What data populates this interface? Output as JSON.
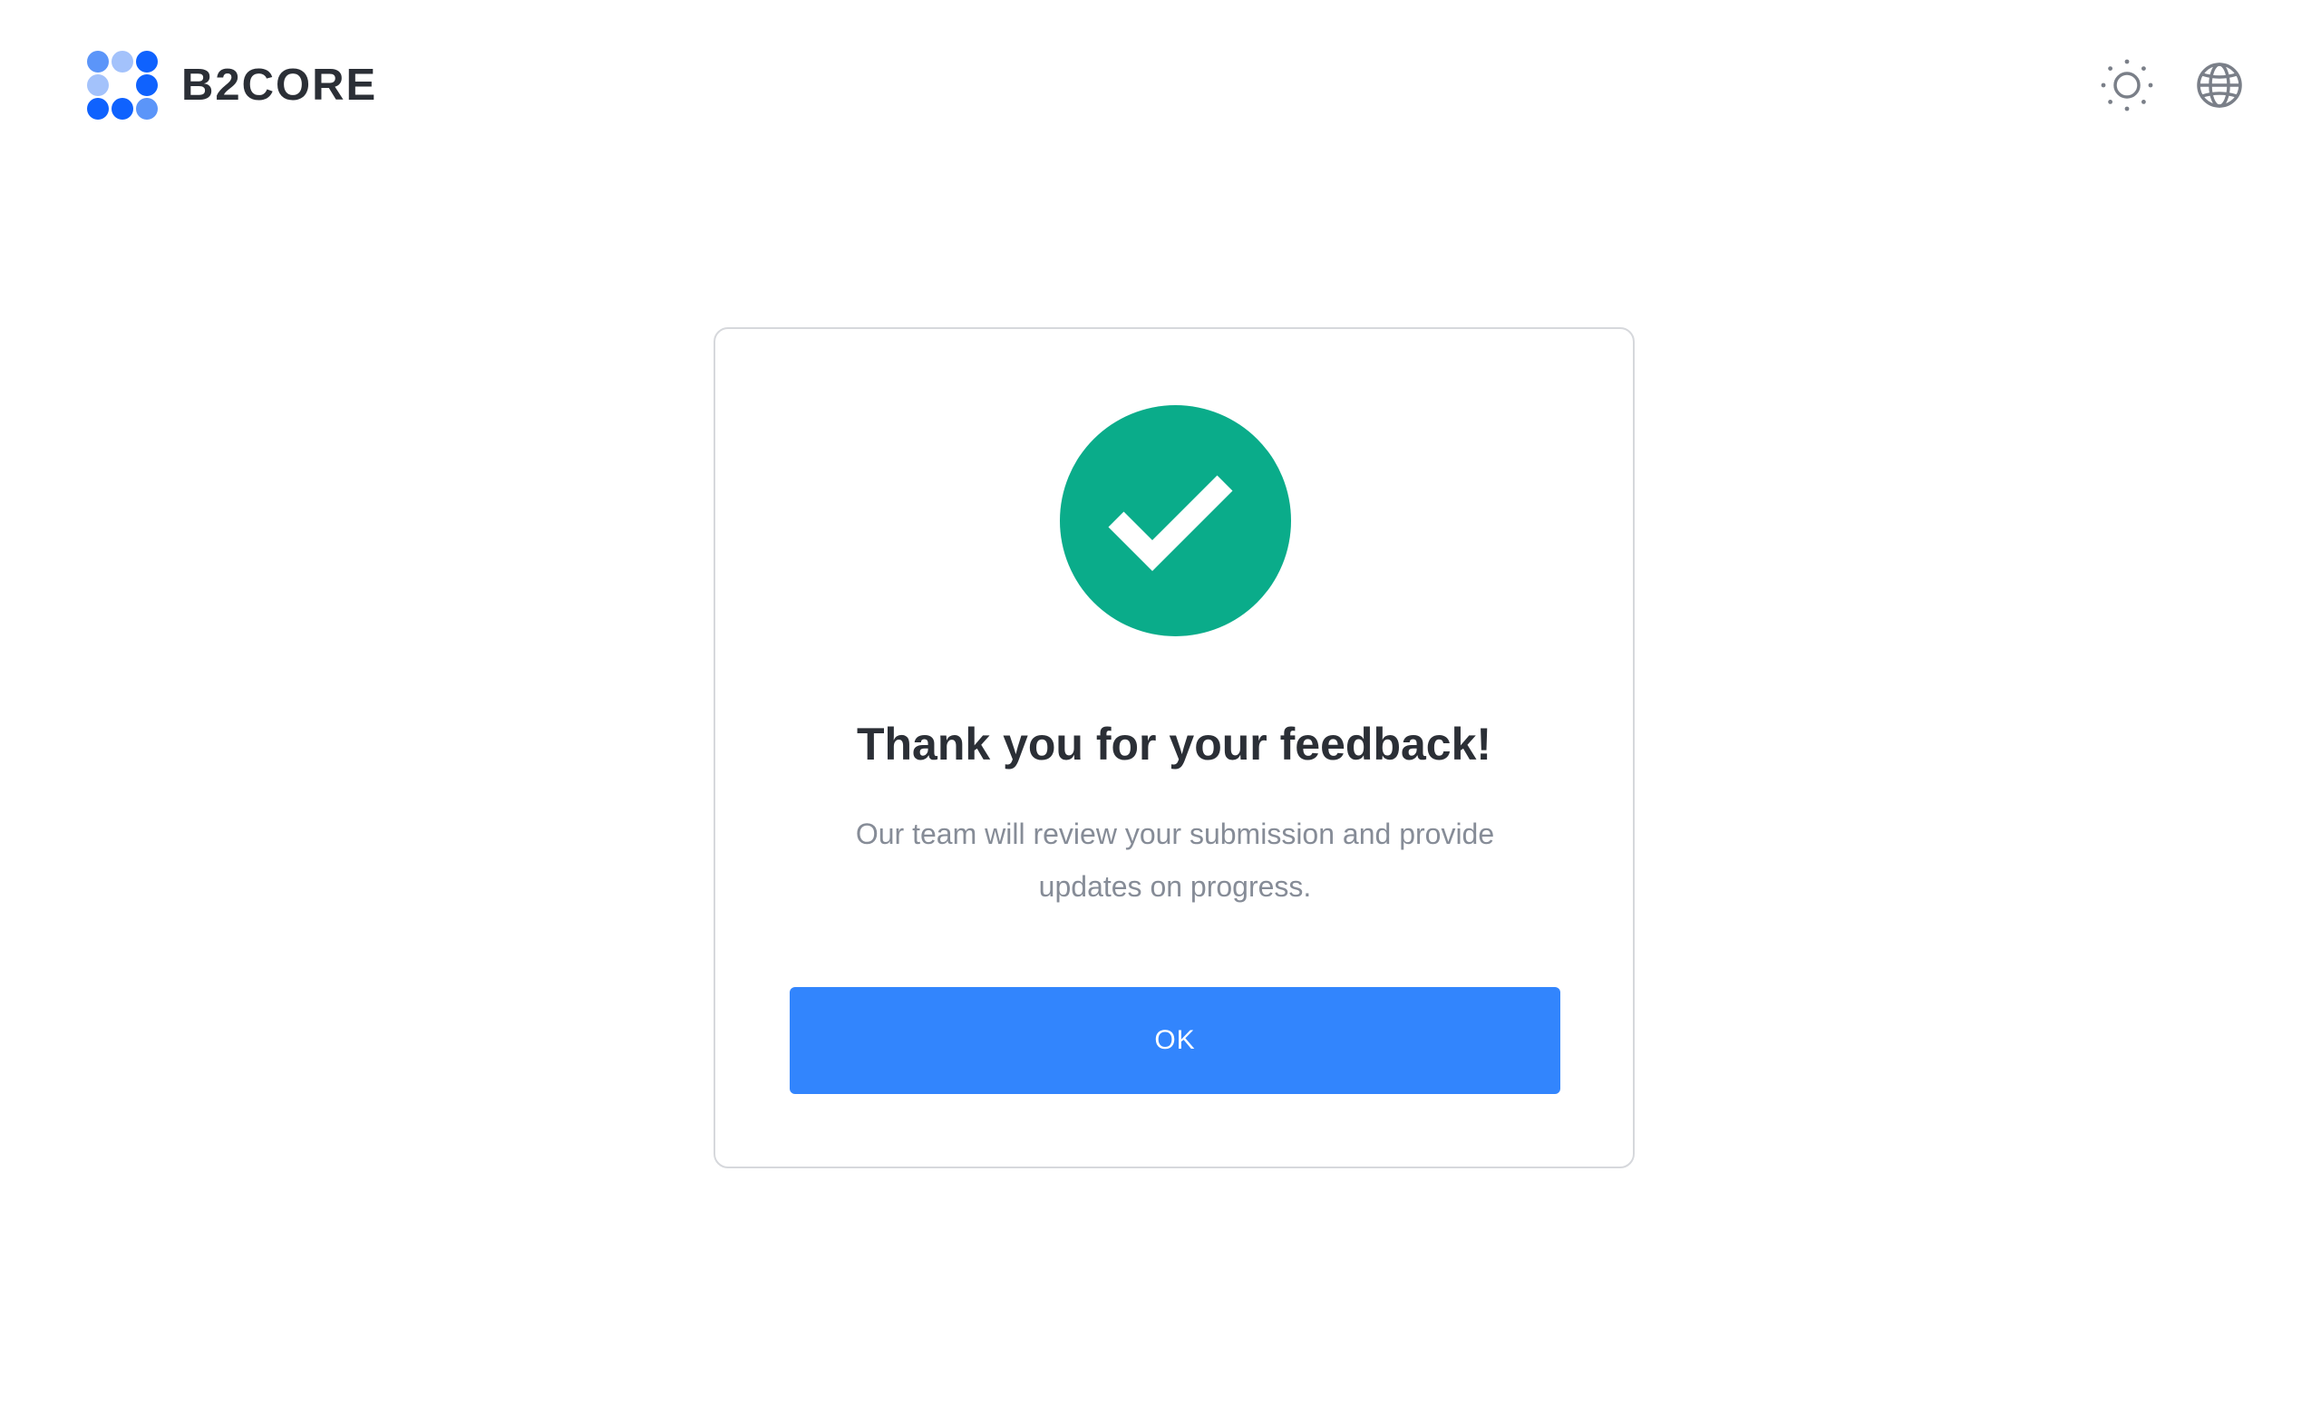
{
  "header": {
    "brand": "B2CORE",
    "logo_icon": "b2core-logo-icon",
    "theme_toggle_icon": "sun-icon",
    "language_icon": "globe-icon"
  },
  "dialog": {
    "icon": "check-circle-icon",
    "title": "Thank you for your feedback!",
    "message": "Our team will review your submission and provide updates on progress.",
    "ok_label": "OK"
  },
  "colors": {
    "brand_blue": "#3285fd",
    "logo_dark_blue": "#0f62fe",
    "logo_mid_blue": "#5b95f9",
    "logo_light_blue": "#a3c2fb",
    "success_green": "#0aac8a",
    "title_text": "#2b2f36",
    "muted_text": "#868c97",
    "icon_gray": "#7a7f88"
  }
}
